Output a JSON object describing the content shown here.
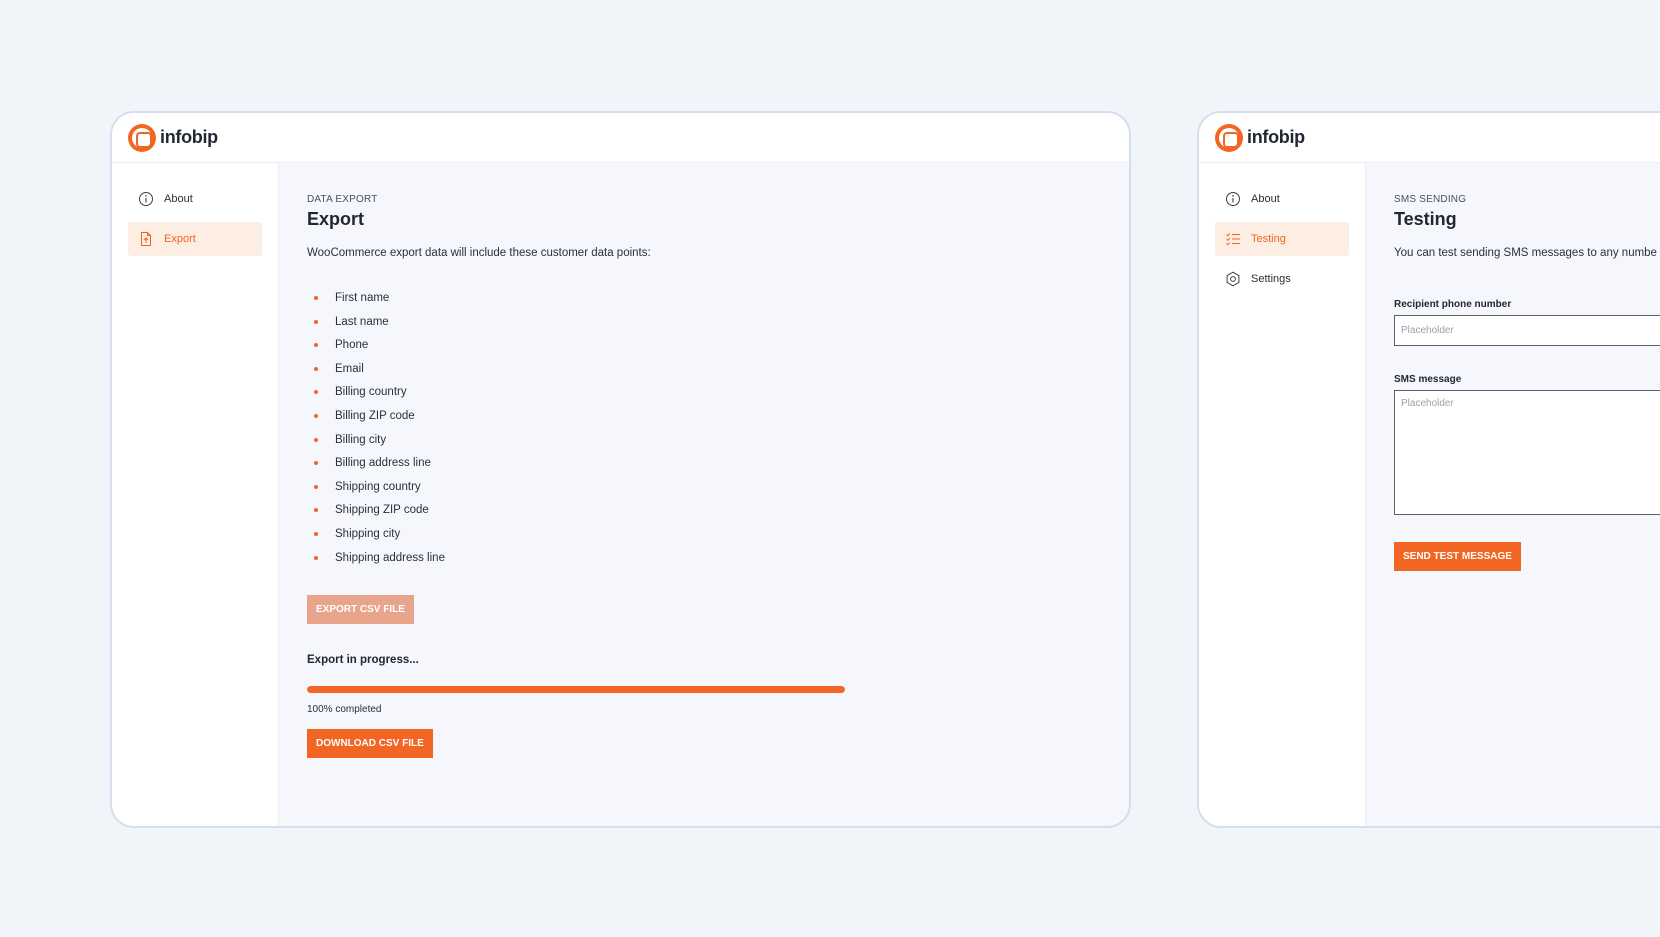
{
  "brand": {
    "name": "infobip",
    "accent": "#f26522",
    "accent_light": "#fdeee4",
    "disabled": "#e9a58b"
  },
  "export_window": {
    "sidebar": {
      "items": [
        {
          "label": "About",
          "icon": "info-icon",
          "active": false
        },
        {
          "label": "Export",
          "icon": "file-export-icon",
          "active": true
        }
      ]
    },
    "eyebrow": "DATA EXPORT",
    "title": "Export",
    "intro": "WooCommerce export data will include these customer data points:",
    "data_points": [
      "First name",
      "Last name",
      "Phone",
      "Email",
      "Billing country",
      "Billing ZIP code",
      "Billing city",
      "Billing address line",
      "Shipping country",
      "Shipping ZIP code",
      "Shipping city",
      "Shipping address line"
    ],
    "export_button": "EXPORT CSV FILE",
    "progress_title": "Export in progress...",
    "progress_value": 1.0,
    "progress_label": "100% completed",
    "download_button": "DOWNLOAD CSV FILE"
  },
  "testing_window": {
    "sidebar": {
      "items": [
        {
          "label": "About",
          "icon": "info-icon",
          "active": false
        },
        {
          "label": "Testing",
          "icon": "checklist-icon",
          "active": true
        },
        {
          "label": "Settings",
          "icon": "gear-icon",
          "active": false
        }
      ]
    },
    "eyebrow": "SMS SENDING",
    "title": "Testing",
    "intro": "You can test sending SMS messages to any numbe",
    "phone_label": "Recipient phone number",
    "phone_placeholder": "Placeholder",
    "message_label": "SMS message",
    "message_placeholder": "Placeholder",
    "send_button": "SEND TEST MESSAGE"
  }
}
